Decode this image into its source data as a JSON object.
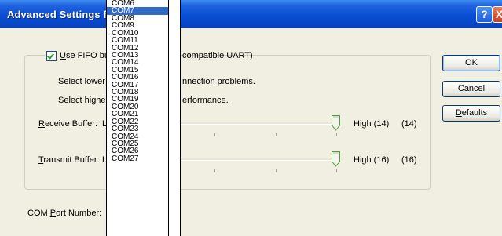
{
  "window": {
    "title": "Advanced Settings f",
    "help_glyph": "?",
    "close_glyph": "X"
  },
  "fifo": {
    "label_underlined": "U",
    "label_rest": "se FIFO bu",
    "label_tail": "compatible UART)",
    "checked": true
  },
  "text": {
    "lower_left": "Select lower",
    "lower_right": "nnection problems.",
    "higher_left": "Select higher",
    "higher_right": "erformance."
  },
  "receive": {
    "label_underlined": "R",
    "label_rest": "eceive Buffer:",
    "low": "L",
    "value_label": "High (14)",
    "value": "(14)"
  },
  "transmit": {
    "label_underlined": "T",
    "label_rest": "ransmit Buffer:",
    "low": "L",
    "value_label": "High (16)",
    "value": "(16)"
  },
  "com_port": {
    "label_prefix": "COM ",
    "label_underlined": "P",
    "label_rest": "ort Number:"
  },
  "buttons": {
    "ok": "OK",
    "cancel": "Cancel",
    "defaults_underlined": "D",
    "defaults_rest": "efaults"
  },
  "dropdown": {
    "selected": "COM7",
    "options": [
      "COM6",
      "COM7",
      "COM8",
      "COM9",
      "COM10",
      "COM11",
      "COM12",
      "COM13",
      "COM14",
      "COM15",
      "COM16",
      "COM17",
      "COM18",
      "COM19",
      "COM20",
      "COM21",
      "COM22",
      "COM23",
      "COM24",
      "COM25",
      "COM26",
      "COM27"
    ]
  },
  "colors": {
    "title_bar": "#0a4fd4",
    "dialog_bg": "#f1efe2",
    "selection": "#316ac5"
  }
}
